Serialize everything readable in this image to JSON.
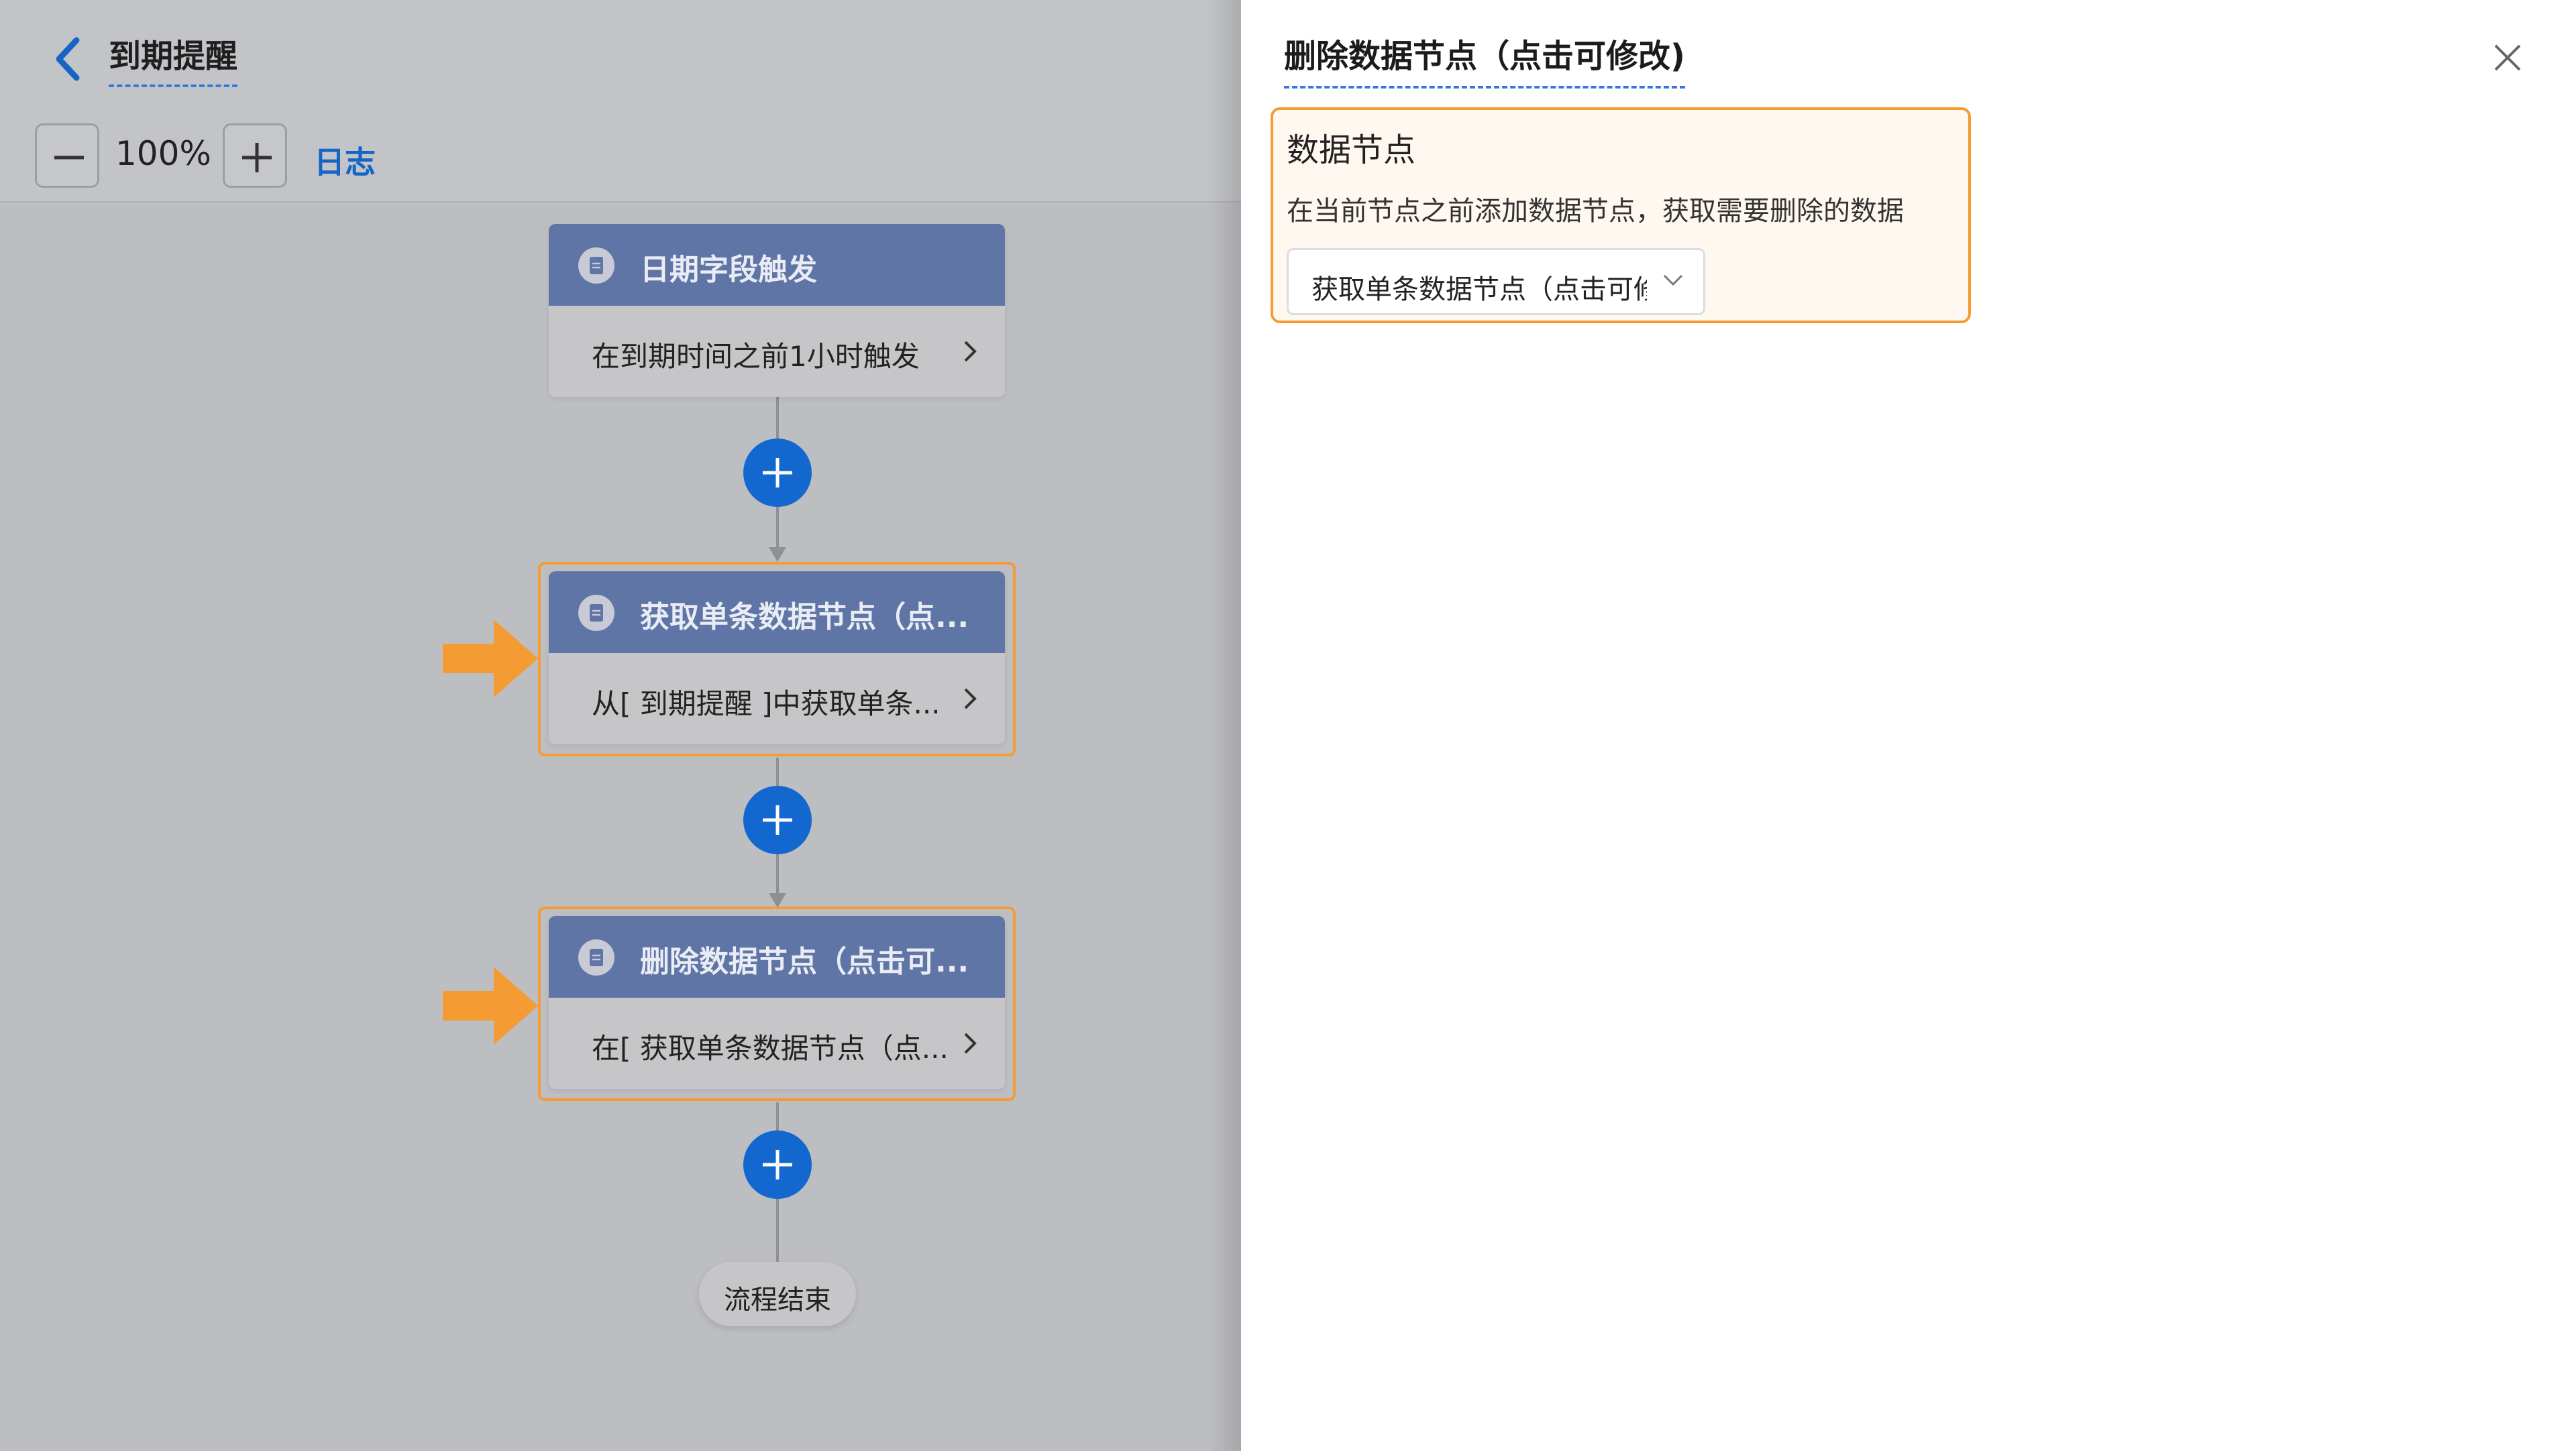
{
  "header": {
    "title": "到期提醒"
  },
  "toolbar": {
    "zoom_out": "−",
    "zoom_value": "100%",
    "zoom_in": "+",
    "log_label": "日志"
  },
  "flow": {
    "nodes": [
      {
        "title": "日期字段触发",
        "desc": "在到期时间之前1小时触发",
        "highlighted": false
      },
      {
        "title": "获取单条数据节点（点...",
        "desc": "从[ 到期提醒 ]中获取单条...",
        "highlighted": true
      },
      {
        "title": "删除数据节点（点击可...",
        "desc": "在[ 获取单条数据节点（点...",
        "highlighted": true
      }
    ],
    "end_label": "流程结束"
  },
  "panel": {
    "title": "删除数据节点（点击可修改)",
    "card": {
      "title": "数据节点",
      "description": "在当前节点之前添加数据节点，获取需要删除的数据",
      "select_value": "获取单条数据节点（点击可修改）"
    }
  },
  "colors": {
    "accent_blue": "#1268cf",
    "highlight_orange": "#f59b33",
    "node_header": "#5f75a6"
  }
}
